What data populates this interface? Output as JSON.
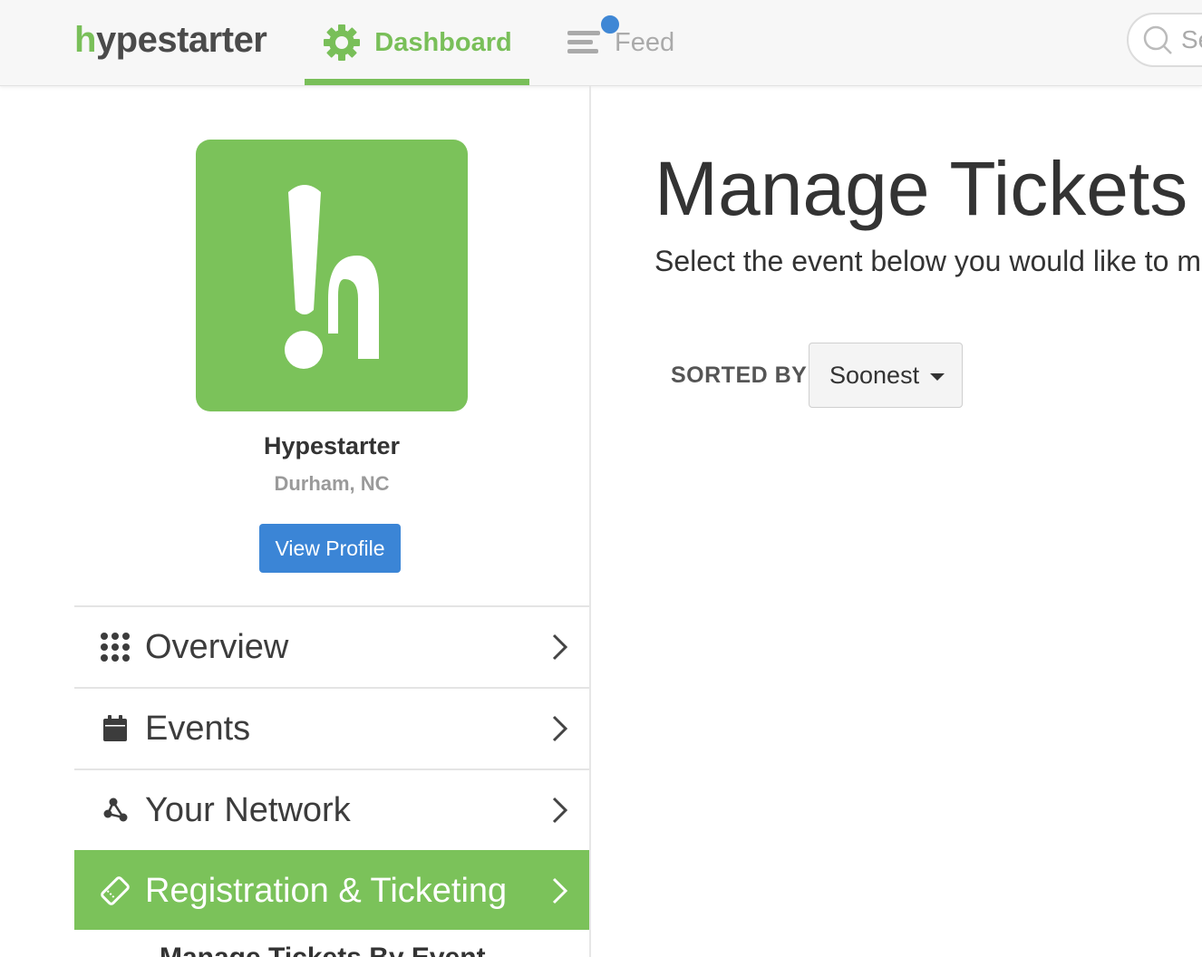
{
  "brand": {
    "logo_prefix": "h",
    "logo_rest": "ypestarter",
    "brand_color": "#79bf59"
  },
  "nav": {
    "tabs": [
      {
        "label": "Dashboard",
        "icon": "gear-icon",
        "active": true
      },
      {
        "label": "Feed",
        "icon": "feed-list-icon",
        "active": false,
        "notification": true
      }
    ],
    "search_placeholder": "Se"
  },
  "sidebar": {
    "profile": {
      "name": "Hypestarter",
      "location": "Durham, NC",
      "view_profile_label": "View Profile"
    },
    "items": [
      {
        "label": "Overview",
        "icon": "grid-dots-icon"
      },
      {
        "label": "Events",
        "icon": "calendar-icon"
      },
      {
        "label": "Your Network",
        "icon": "network-icon"
      },
      {
        "label": "Registration & Ticketing",
        "icon": "ticket-icon",
        "active": true
      }
    ],
    "submenu_peek": "Manage Tickets By Event"
  },
  "main": {
    "title": "Manage Tickets",
    "subtitle": "Select the event below you would like to m",
    "sort_label": "SORTED BY",
    "sort_value": "Soonest"
  },
  "colors": {
    "accent_green": "#7bc25a",
    "button_blue": "#3b85d6",
    "notification_blue": "#3f87d5"
  }
}
